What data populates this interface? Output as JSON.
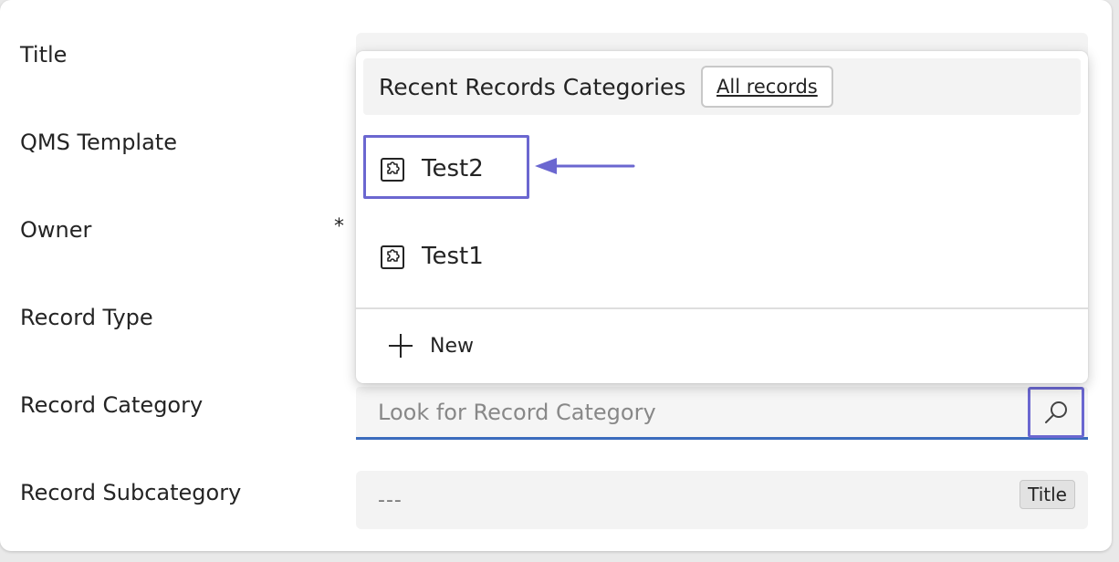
{
  "form": {
    "fields": [
      {
        "label": "Title"
      },
      {
        "label": "QMS Template"
      },
      {
        "label": "Owner",
        "required_mark": "*"
      },
      {
        "label": "Record Type"
      },
      {
        "label": "Record Category"
      },
      {
        "label": "Record Subcategory"
      }
    ],
    "record_category": {
      "placeholder": "Look for Record Category",
      "search_icon": "search-icon"
    },
    "record_subcategory": {
      "value": "---",
      "badge": "Title"
    }
  },
  "dropdown": {
    "header_title": "Recent Records Categories",
    "all_records_label": "All records",
    "items": [
      {
        "label": "Test2",
        "icon": "puzzle-icon",
        "highlighted": true
      },
      {
        "label": "Test1",
        "icon": "puzzle-icon",
        "highlighted": false
      }
    ],
    "new_label": "New",
    "new_icon": "plus-icon"
  },
  "colors": {
    "accent_highlight": "#6b67d0",
    "input_underline": "#3b6bbd",
    "field_background": "#f3f3f3"
  }
}
